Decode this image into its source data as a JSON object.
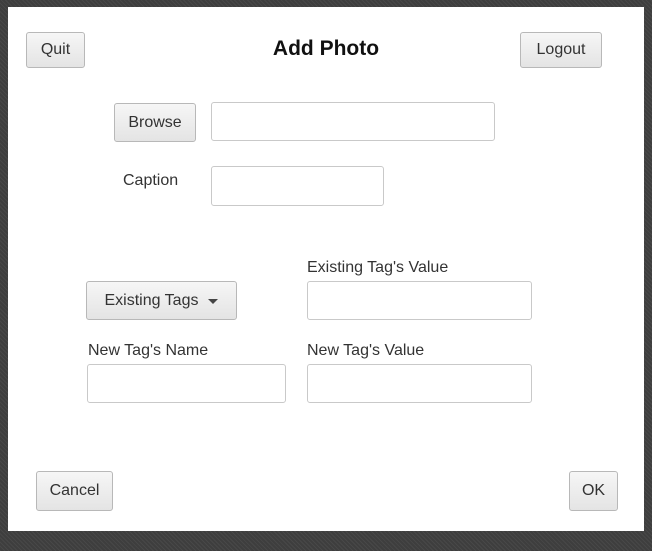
{
  "window": {
    "title": "Add Photo"
  },
  "header": {
    "quit_label": "Quit",
    "logout_label": "Logout"
  },
  "browse": {
    "button_label": "Browse",
    "path_value": "",
    "path_placeholder": ""
  },
  "caption": {
    "label": "Caption",
    "value": "",
    "placeholder": ""
  },
  "existing_tags": {
    "dropdown_label": "Existing Tags",
    "value_label": "Existing Tag's Value",
    "value": ""
  },
  "new_tag": {
    "name_label": "New Tag's Name",
    "name_value": "",
    "value_label": "New Tag's Value",
    "value_value": ""
  },
  "footer": {
    "cancel_label": "Cancel",
    "ok_label": "OK"
  },
  "icons": {
    "dropdown": "chevron-down-icon"
  }
}
